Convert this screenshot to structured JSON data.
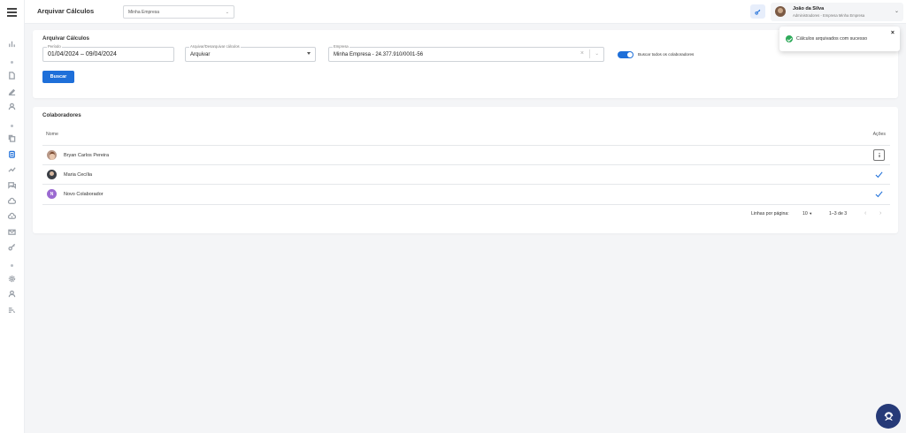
{
  "header": {
    "title": "Arquivar Cálculos",
    "company_select": "Minha Empresa",
    "user": {
      "name": "João da Silva",
      "role": "Administradores - Empresa Minha Empresa"
    }
  },
  "sidebar": {
    "icons": [
      "menu-icon",
      "chart-icon",
      "document-icon",
      "pen-icon",
      "person-icon",
      "copy-icon",
      "calculator-icon",
      "trend-icon",
      "chat-icon",
      "cloud-icon",
      "cloud-upload-icon",
      "mail-icon",
      "key-icon",
      "gear-icon",
      "user-icon",
      "report-icon"
    ],
    "active": "calculator-icon"
  },
  "filter": {
    "title": "Arquivar Cálculos",
    "period": {
      "label": "Período",
      "value": "01/04/2024 – 09/04/2024"
    },
    "action": {
      "label": "Arquivar/Desarquivar cálculos",
      "value": "Arquivar"
    },
    "company": {
      "label": "Empresa",
      "value": "Minha Empresa - 24.377.910/0001-56"
    },
    "toggle": {
      "label": "Buscar todos os colaboradores",
      "on": true
    },
    "search_button": "Buscar"
  },
  "employees": {
    "title": "Colaboradores",
    "columns": {
      "name": "Nome",
      "actions": "Ações"
    },
    "rows": [
      {
        "name": "Bryan Carlos Pereira",
        "status": "pending"
      },
      {
        "name": "Maria Cecília",
        "status": "done"
      },
      {
        "name": "Novo Colaborador",
        "status": "done",
        "initial": "N"
      }
    ],
    "pagination": {
      "rows_per_page_label": "Linhas por página:",
      "rows_per_page": "10",
      "range": "1–3 de 3"
    }
  },
  "toast": {
    "message": "Cálculos arquivados com sucesso",
    "type": "success"
  },
  "colors": {
    "primary": "#1e6fd9",
    "success": "#2eaa5a",
    "fab": "#263a78"
  }
}
